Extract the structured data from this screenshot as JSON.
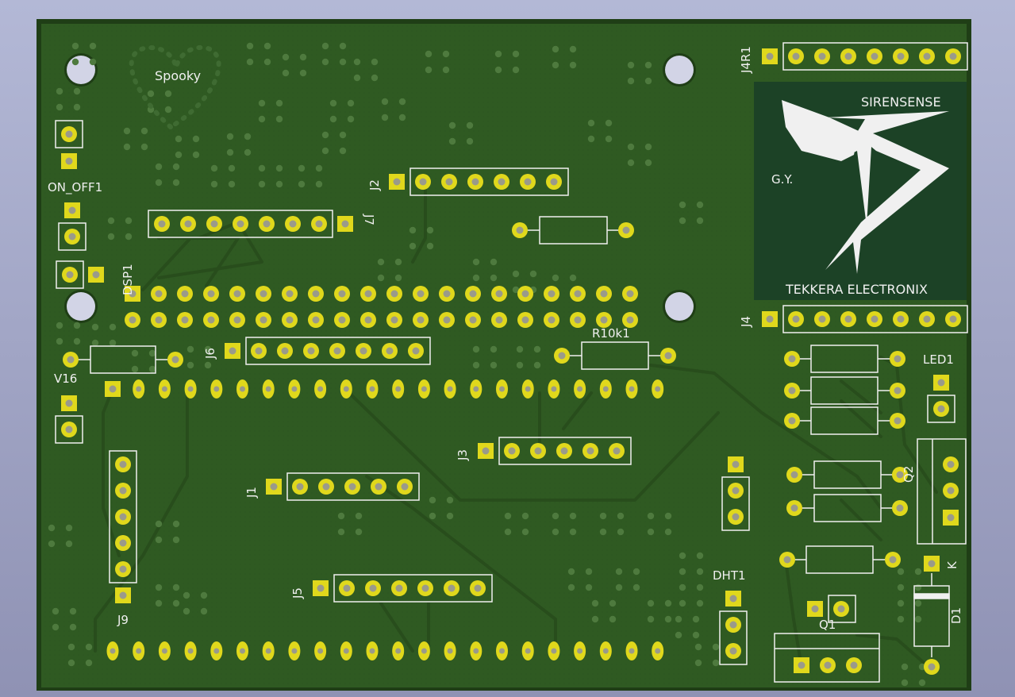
{
  "board": {
    "silkscreen_color": "#f0f0f0",
    "copper_color": "#e0d81c",
    "board_color": "#2f5a22",
    "labels": {
      "spooky": "Spooky",
      "on_off": "ON_OFF1",
      "dsp": "DSP1",
      "v16": "V16",
      "j1": "J1",
      "j2": "J2",
      "j3": "J3",
      "j4": "J4",
      "j4r1": "J4R1",
      "j5": "J5",
      "j6": "J6",
      "j7": "J7",
      "j9": "J9",
      "r10k1": "R10k1",
      "led1": "LED1",
      "q1": "Q1",
      "q2": "Q2",
      "d1": "D1",
      "k": "K",
      "dht1": "DHT1"
    },
    "logo": {
      "brand": "SIRENSENSE",
      "initials": "G.Y.",
      "maker": "TEKKERA ELECTRONIX"
    }
  }
}
